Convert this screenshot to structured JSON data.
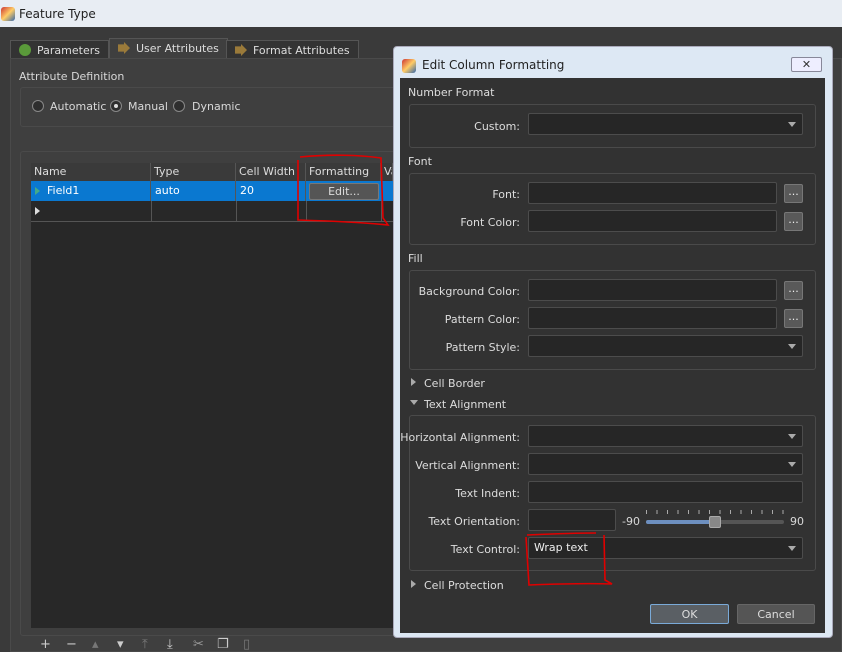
{
  "window": {
    "title": "Feature Type"
  },
  "tabs": [
    {
      "label": "Parameters",
      "icon": "gear-icon"
    },
    {
      "label": "User Attributes",
      "icon": "arrow-icon",
      "active": true
    },
    {
      "label": "Format Attributes",
      "icon": "arrow-icon"
    }
  ],
  "attribute_definition": {
    "label": "Attribute Definition",
    "options": [
      "Automatic",
      "Manual",
      "Dynamic"
    ],
    "selected": "Manual"
  },
  "table": {
    "columns": [
      "Name",
      "Type",
      "Cell Width",
      "Formatting",
      "Va"
    ],
    "rows": [
      {
        "name": "Field1",
        "type": "auto",
        "cell_width": "20",
        "formatting": "Edit..."
      }
    ],
    "selection_color": "#0a78d0"
  },
  "dialog": {
    "title": "Edit Column Formatting",
    "close": "✕",
    "number_format": {
      "label": "Number Format",
      "custom_label": "Custom:",
      "custom_value": ""
    },
    "font": {
      "label": "Font",
      "font_label": "Font:",
      "font_color_label": "Font Color:",
      "browse": "..."
    },
    "fill": {
      "label": "Fill",
      "bg_label": "Background Color:",
      "pattern_color_label": "Pattern Color:",
      "pattern_style_label": "Pattern Style:"
    },
    "cell_border": {
      "label": "Cell Border",
      "expanded": false
    },
    "text_alignment": {
      "label": "Text Alignment",
      "expanded": true,
      "h_label": "Horizontal Alignment:",
      "v_label": "Vertical Alignment:",
      "indent_label": "Text Indent:",
      "orientation_label": "Text Orientation:",
      "orientation_min": "-90",
      "orientation_max": "90",
      "orientation_value": 0,
      "control_label": "Text Control:",
      "control_value": "Wrap text"
    },
    "cell_protection": {
      "label": "Cell Protection",
      "expanded": false
    },
    "ok": "OK",
    "cancel": "Cancel"
  },
  "annotation_color": "#e00000"
}
